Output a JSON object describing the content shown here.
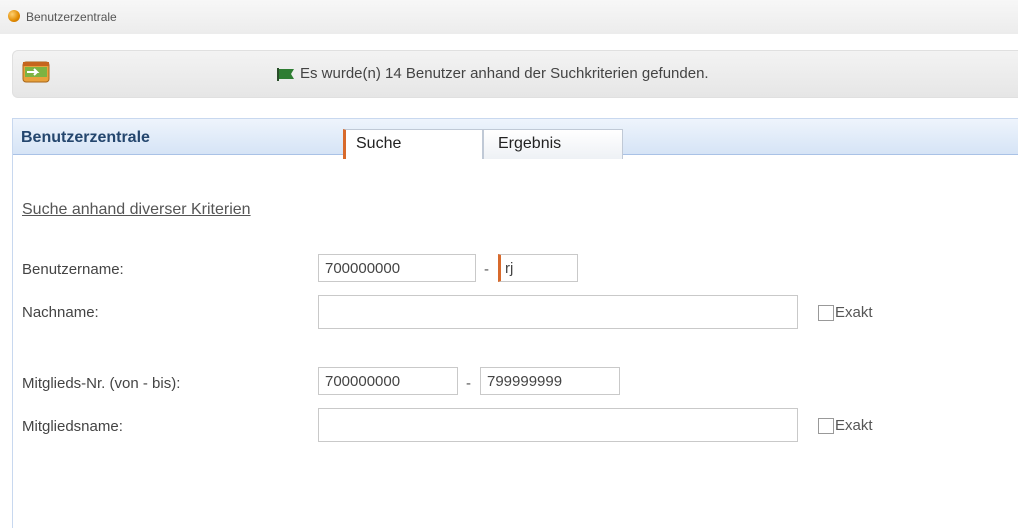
{
  "window": {
    "title": "Benutzerzentrale"
  },
  "message": {
    "text": "Es wurde(n) 14 Benutzer anhand der Suchkriterien gefunden."
  },
  "panel": {
    "title": "Benutzerzentrale",
    "tabs": [
      {
        "label": "Suche"
      },
      {
        "label": "Ergebnis"
      }
    ],
    "section_title": "Suche anhand diverser Kriterien"
  },
  "form": {
    "benutzername": {
      "label": "Benutzername:",
      "from": "700000000",
      "to": "rj"
    },
    "nachname": {
      "label": "Nachname:",
      "value": "",
      "exakt_label": "Exakt"
    },
    "mitgliedsnr": {
      "label": "Mitglieds-Nr. (von - bis):",
      "from": "700000000",
      "to": "799999999"
    },
    "mitgliedsname": {
      "label": "Mitgliedsname:",
      "value": "",
      "exakt_label": "Exakt"
    },
    "dash": "-"
  }
}
